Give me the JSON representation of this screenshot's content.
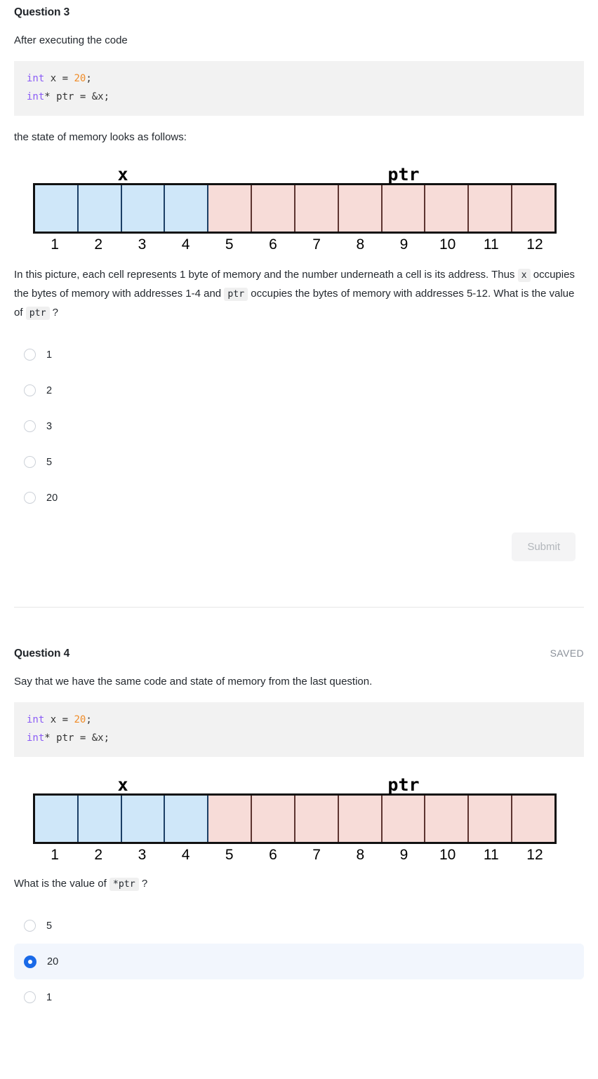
{
  "questions": [
    {
      "title": "Question 3",
      "status": "",
      "intro": "After executing the code",
      "code": {
        "line1_kw": "int",
        "line1_mid": " x = ",
        "line1_num": "20",
        "line1_end": ";",
        "line2_kw": "int",
        "line2_rest": "* ptr = &x;"
      },
      "after_code": "the state of memory looks as follows:",
      "diagram": {
        "label_x": "x",
        "label_ptr": "ptr",
        "blue_cells": 4,
        "pink_cells": 8,
        "addresses": [
          "1",
          "2",
          "3",
          "4",
          "5",
          "6",
          "7",
          "8",
          "9",
          "10",
          "11",
          "12"
        ]
      },
      "explanation": {
        "part1": "In this picture, each cell represents 1 byte of memory and the number underneath a cell is its address.  Thus ",
        "code1": "x",
        "part2": " occupies the bytes of memory with addresses 1-4 and ",
        "code2": "ptr",
        "part3": " occupies the bytes of memory with addresses 5-12.  What is the value of ",
        "code3": "ptr",
        "part4": " ?"
      },
      "options": [
        {
          "label": "1",
          "selected": false
        },
        {
          "label": "2",
          "selected": false
        },
        {
          "label": "3",
          "selected": false
        },
        {
          "label": "5",
          "selected": false
        },
        {
          "label": "20",
          "selected": false
        }
      ],
      "submit_label": "Submit"
    },
    {
      "title": "Question 4",
      "status": "SAVED",
      "intro": "Say that we have the same code and state of memory from the last question.",
      "code": {
        "line1_kw": "int",
        "line1_mid": " x = ",
        "line1_num": "20",
        "line1_end": ";",
        "line2_kw": "int",
        "line2_rest": "* ptr = &x;"
      },
      "diagram": {
        "label_x": "x",
        "label_ptr": "ptr",
        "blue_cells": 4,
        "pink_cells": 8,
        "addresses": [
          "1",
          "2",
          "3",
          "4",
          "5",
          "6",
          "7",
          "8",
          "9",
          "10",
          "11",
          "12"
        ]
      },
      "question_text": {
        "part1": "What is the value of ",
        "code1": "*ptr",
        "part2": " ?"
      },
      "options": [
        {
          "label": "5",
          "selected": false
        },
        {
          "label": "20",
          "selected": true
        },
        {
          "label": "1",
          "selected": false
        }
      ]
    }
  ],
  "colors": {
    "cell_blue": "#cfe7f9",
    "cell_pink": "#f7dcd8",
    "radio_selected": "#1a6ae8",
    "selected_row_bg": "#f2f6fd",
    "keyword": "#8b5cf6",
    "number_literal": "#f08c28"
  }
}
